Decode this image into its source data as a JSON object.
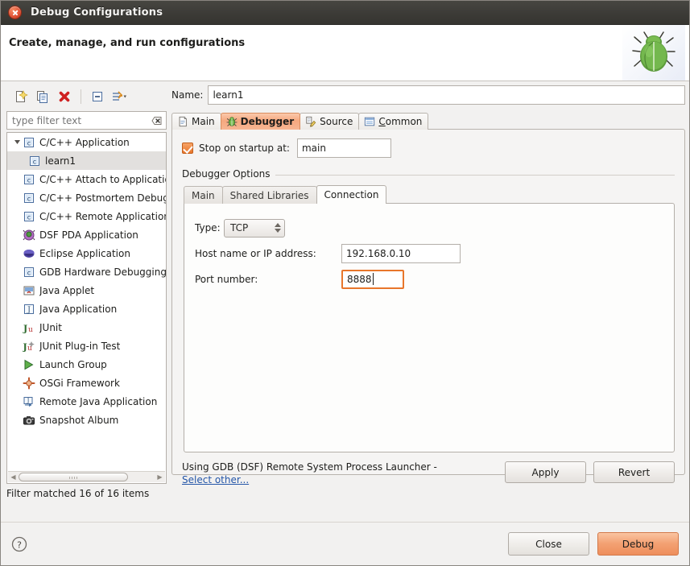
{
  "window": {
    "title": "Debug Configurations",
    "close_icon": "close-icon"
  },
  "banner": {
    "title": "Create, manage, and run configurations",
    "art_icon": "bug-icon"
  },
  "toolbar": {
    "buttons": [
      {
        "name": "new-configuration-button",
        "icon": "new-document-icon"
      },
      {
        "name": "duplicate-configuration-button",
        "icon": "copy-icon"
      },
      {
        "name": "delete-configuration-button",
        "icon": "delete-x-icon"
      },
      {
        "name": "collapse-all-button",
        "icon": "collapse-all-icon"
      },
      {
        "name": "filter-menu-button",
        "icon": "filter-icon"
      }
    ]
  },
  "filter": {
    "placeholder": "type filter text",
    "value": "",
    "clear_icon": "clear-icon",
    "status": "Filter matched 16 of 16 items"
  },
  "tree": {
    "items": [
      {
        "label": "C/C++ Application",
        "icon": "c-file-icon",
        "level": 0,
        "expanded": true,
        "selected": false
      },
      {
        "label": "learn1",
        "icon": "c-file-icon",
        "level": 1,
        "expanded": false,
        "selected": true
      },
      {
        "label": "C/C++ Attach to Application",
        "icon": "c-file-icon",
        "level": 0,
        "expanded": false,
        "selected": false
      },
      {
        "label": "C/C++ Postmortem Debugger",
        "icon": "c-file-icon",
        "level": 0,
        "expanded": false,
        "selected": false
      },
      {
        "label": "C/C++ Remote Application",
        "icon": "c-file-icon",
        "level": 0,
        "expanded": false,
        "selected": false
      },
      {
        "label": "DSF PDA Application",
        "icon": "pda-icon",
        "level": 0,
        "expanded": false,
        "selected": false
      },
      {
        "label": "Eclipse Application",
        "icon": "eclipse-icon",
        "level": 0,
        "expanded": false,
        "selected": false
      },
      {
        "label": "GDB Hardware Debugging",
        "icon": "c-file-icon",
        "level": 0,
        "expanded": false,
        "selected": false
      },
      {
        "label": "Java Applet",
        "icon": "java-applet-icon",
        "level": 0,
        "expanded": false,
        "selected": false
      },
      {
        "label": "Java Application",
        "icon": "java-icon",
        "level": 0,
        "expanded": false,
        "selected": false
      },
      {
        "label": "JUnit",
        "icon": "junit-icon",
        "level": 0,
        "expanded": false,
        "selected": false
      },
      {
        "label": "JUnit Plug-in Test",
        "icon": "junit-plugin-icon",
        "level": 0,
        "expanded": false,
        "selected": false
      },
      {
        "label": "Launch Group",
        "icon": "launch-group-icon",
        "level": 0,
        "expanded": false,
        "selected": false
      },
      {
        "label": "OSGi Framework",
        "icon": "osgi-icon",
        "level": 0,
        "expanded": false,
        "selected": false
      },
      {
        "label": "Remote Java Application",
        "icon": "remote-java-icon",
        "level": 0,
        "expanded": false,
        "selected": false
      },
      {
        "label": "Snapshot Album",
        "icon": "camera-icon",
        "level": 0,
        "expanded": false,
        "selected": false
      }
    ]
  },
  "config": {
    "name_label": "Name:",
    "name_value": "learn1",
    "tabs": [
      {
        "label": "Main",
        "icon": "document-icon",
        "active": false,
        "mnemonic": ""
      },
      {
        "label": "Debugger",
        "icon": "bug-icon",
        "active": true,
        "mnemonic": ""
      },
      {
        "label": "Source",
        "icon": "source-pencil-icon",
        "active": false,
        "mnemonic": ""
      },
      {
        "label": "Common",
        "icon": "common-list-icon",
        "active": false,
        "mnemonic": "C"
      }
    ]
  },
  "debugger": {
    "stop_on_startup": {
      "label": "Stop on startup at:",
      "checked": true,
      "value": "main"
    },
    "options_group_title": "Debugger Options",
    "inner_tabs": [
      {
        "label": "Main",
        "active": false
      },
      {
        "label": "Shared Libraries",
        "active": false
      },
      {
        "label": "Connection",
        "active": true
      }
    ],
    "connection": {
      "type_label": "Type:",
      "type_value": "TCP",
      "host_label": "Host name or IP address:",
      "host_value": "192.168.0.10",
      "port_label": "Port number:",
      "port_value": "8888",
      "port_focused": true
    }
  },
  "launcher": {
    "text": "Using GDB (DSF) Remote System Process Launcher -",
    "link": "Select other...",
    "apply_label": "Apply",
    "revert_label": "Revert"
  },
  "footer": {
    "help_icon": "help-icon",
    "close_label": "Close",
    "debug_label": "Debug"
  },
  "colors": {
    "accent_orange": "#e8762b",
    "titlebar": "#3b3a36",
    "link_blue": "#2456a8",
    "selection": "#e2e0de"
  }
}
